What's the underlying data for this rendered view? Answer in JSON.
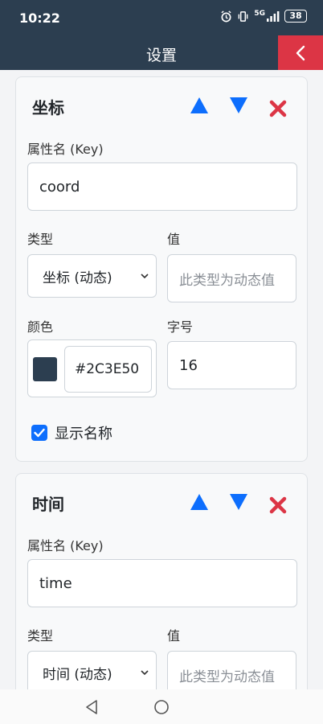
{
  "status": {
    "time": "10:22",
    "signal": "5G",
    "battery": "38"
  },
  "header": {
    "title": "设置"
  },
  "colors": {
    "header_bg": "#2c3e50",
    "back_bg": "#dc3545",
    "up_arrow": "#0d6efd",
    "down_arrow": "#0d6efd",
    "delete": "#dc3545",
    "accent": "#0d6efd"
  },
  "cards": [
    {
      "title": "坐标",
      "key_label": "属性名 (Key)",
      "key_value": "coord",
      "type_label": "类型",
      "type_value": "坐标 (动态)",
      "value_label": "值",
      "value_placeholder": "此类型为动态值",
      "color_label": "颜色",
      "color_value": "#2C3E50",
      "size_label": "字号",
      "size_value": "16",
      "show_name_label": "显示名称"
    },
    {
      "title": "时间",
      "key_label": "属性名 (Key)",
      "key_value": "time",
      "type_label": "类型",
      "type_value": "时间 (动态)",
      "value_label": "值",
      "value_placeholder": "此类型为动态值"
    }
  ]
}
